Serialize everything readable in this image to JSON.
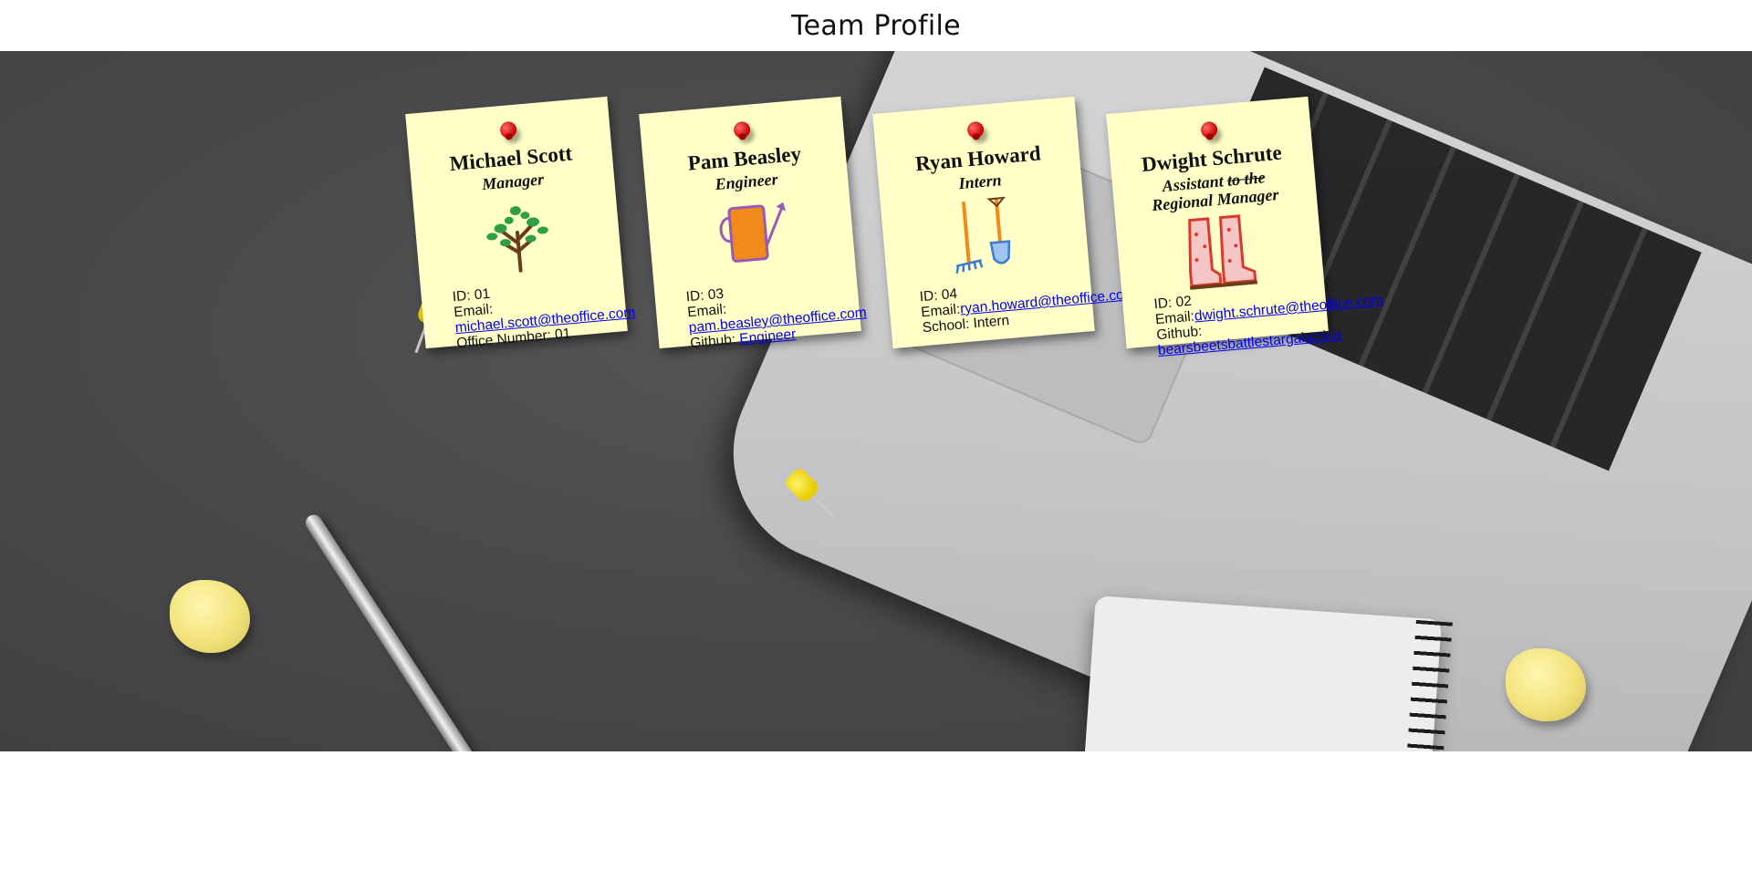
{
  "header": {
    "title": "Team Profile"
  },
  "team": [
    {
      "name": "Michael Scott",
      "role": "Manager",
      "id_label": "ID: 01",
      "email_label": "Email:",
      "email": "michael.scott@theoffice.com",
      "extra_label": "Office Number: 01",
      "icon": "tree-icon"
    },
    {
      "name": "Pam Beasley",
      "role": "Engineer",
      "id_label": "ID: 03",
      "email_label": "Email:",
      "email": "pam.beasley@theoffice.com",
      "extra_label": "Github:",
      "extra_link": "Engineer",
      "icon": "watering-can-icon"
    },
    {
      "name": "Ryan Howard",
      "role": "Intern",
      "id_label": "ID: 04",
      "email_label": "Email:",
      "email": "ryan.howard@theoffice.com",
      "extra_label": "School: Intern",
      "icon": "rake-and-shovel-icon"
    },
    {
      "name": "Dwight Schrute",
      "role_prefix": "Assistant",
      "role_struck": "to the",
      "role_suffix": "Regional Manager",
      "id_label": "ID: 02",
      "email_label": "Email:",
      "email": "dwight.schrute@theoffice.com",
      "extra_label": "Github:",
      "extra_link": "bearsbeetsbattlestargalactica",
      "icon": "rain-boots-icon"
    }
  ],
  "colors": {
    "note": "#ffffc7",
    "link": "#0000ee",
    "desk": "#4a4a4c"
  }
}
